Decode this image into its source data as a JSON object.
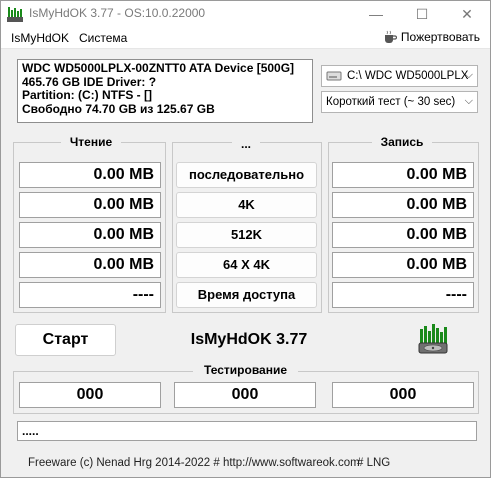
{
  "window": {
    "title": "IsMyHdOK 3.77 - OS:10.0.22000",
    "minimize_glyph": "—",
    "maximize_glyph": "☐",
    "close_glyph": "✕"
  },
  "menu": {
    "items": [
      "IsMyHdOK",
      "Система"
    ],
    "donate_label": "Пожертвовать",
    "donate_icon": "coffee-cup-icon"
  },
  "drive_info": {
    "line1": "WDC WD5000LPLX-00ZNTT0 ATA Device [500G]",
    "line2": "465.76 GB  IDE Driver: ?",
    "line3": "Partition: (C:) NTFS - []",
    "line4": "Свободно 74.70 GB из 125.67 GB"
  },
  "drive_select": {
    "value": "C:\\ WDC WD5000LPLX"
  },
  "test_select": {
    "value": "Короткий тест (~ 30 sec)"
  },
  "read_panel": {
    "title": "Чтение",
    "values": [
      "0.00 MB",
      "0.00 MB",
      "0.00 MB",
      "0.00 MB",
      "----"
    ]
  },
  "mode_panel": {
    "title": "...",
    "buttons": [
      "последовательно",
      "4K",
      "512K",
      "64 X 4K",
      "Время доступа"
    ]
  },
  "write_panel": {
    "title": "Запись",
    "values": [
      "0.00 MB",
      "0.00 MB",
      "0.00 MB",
      "0.00 MB",
      "----"
    ]
  },
  "start_label": "Старт",
  "app_name": "IsMyHdOK 3.77",
  "testing": {
    "title": "Тестирование",
    "values": [
      "000",
      "000",
      "000"
    ]
  },
  "status_text": ".....",
  "footer": {
    "copyright": "Freeware (c) Nenad Hrg 2014-2022 # http://www.softwareok.com",
    "lng": "# LNG"
  },
  "colors": {
    "accent_green": "#1a8a1a",
    "title_gray": "#7a7a7a"
  }
}
